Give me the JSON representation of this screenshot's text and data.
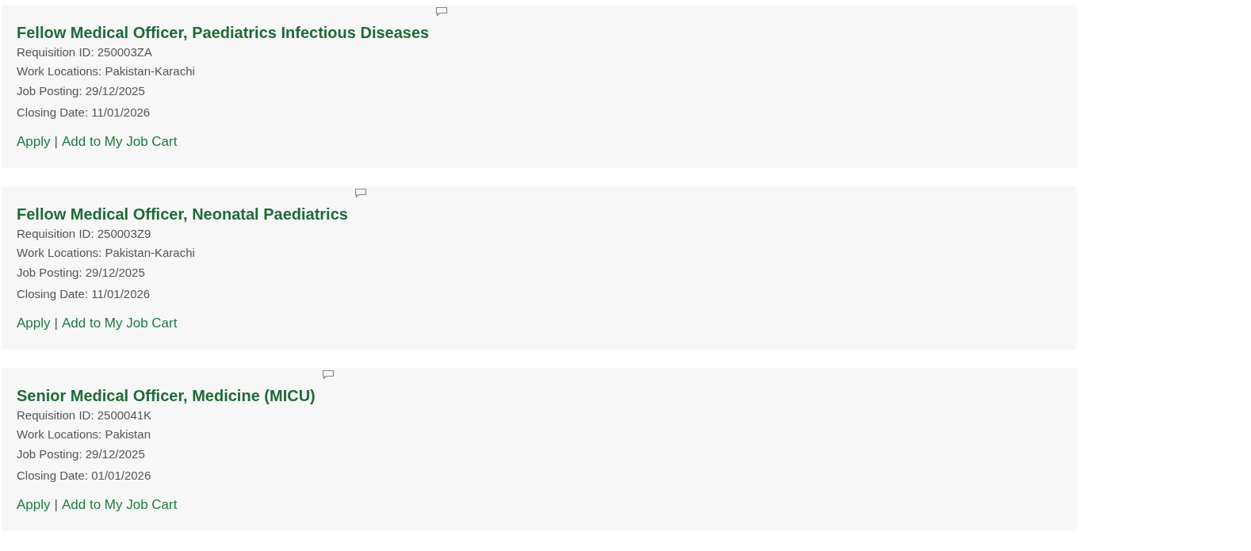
{
  "jobs": [
    {
      "title": "Fellow Medical Officer, Paediatrics Infectious Diseases",
      "requisition": "Requisition ID: 250003ZA",
      "locations": "Work Locations: Pakistan-Karachi",
      "posting": "Job Posting: 29/12/2025",
      "closing": "Closing Date: 11/01/2026",
      "apply": "Apply",
      "separator": "|",
      "cart": "Add to My Job Cart"
    },
    {
      "title": "Fellow Medical Officer, Neonatal Paediatrics",
      "requisition": "Requisition ID: 250003Z9",
      "locations": "Work Locations: Pakistan-Karachi",
      "posting": "Job Posting: 29/12/2025",
      "closing": "Closing Date: 11/01/2026",
      "apply": "Apply",
      "separator": "|",
      "cart": "Add to My Job Cart"
    },
    {
      "title": "Senior Medical Officer, Medicine (MICU)",
      "requisition": "Requisition ID: 2500041K",
      "locations": "Work Locations: Pakistan",
      "posting": "Job Posting: 29/12/2025",
      "closing": "Closing Date: 01/01/2026",
      "apply": "Apply",
      "separator": "|",
      "cart": "Add to My Job Cart"
    }
  ]
}
